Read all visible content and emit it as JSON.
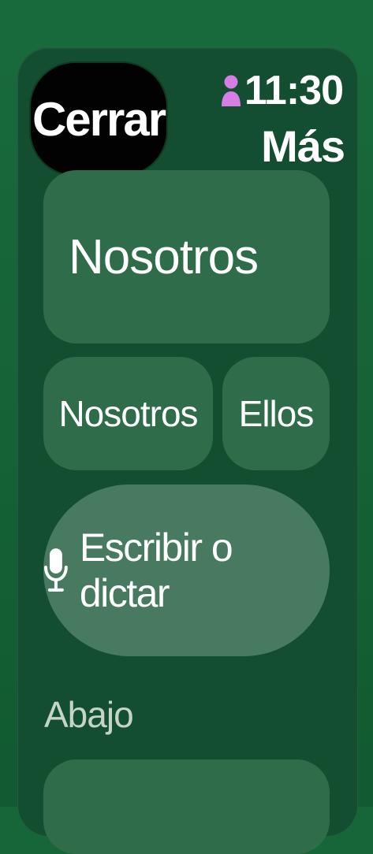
{
  "header": {
    "close_label": "Cerrar",
    "time": "11:30",
    "more_label": "Más",
    "person_icon_color": "#d67ee6"
  },
  "suggestions": {
    "primary": "Nosotros",
    "options": [
      "Nosotros",
      "Ellos"
    ]
  },
  "input": {
    "label": "Escribir o dictar",
    "icon": "microphone-icon"
  },
  "section": {
    "title": "Abajo"
  },
  "colors": {
    "background": "#17663a",
    "sheet": "#134e30",
    "tile": "#2e6c4a",
    "dictation": "#487a60",
    "close_button": "#020202"
  }
}
